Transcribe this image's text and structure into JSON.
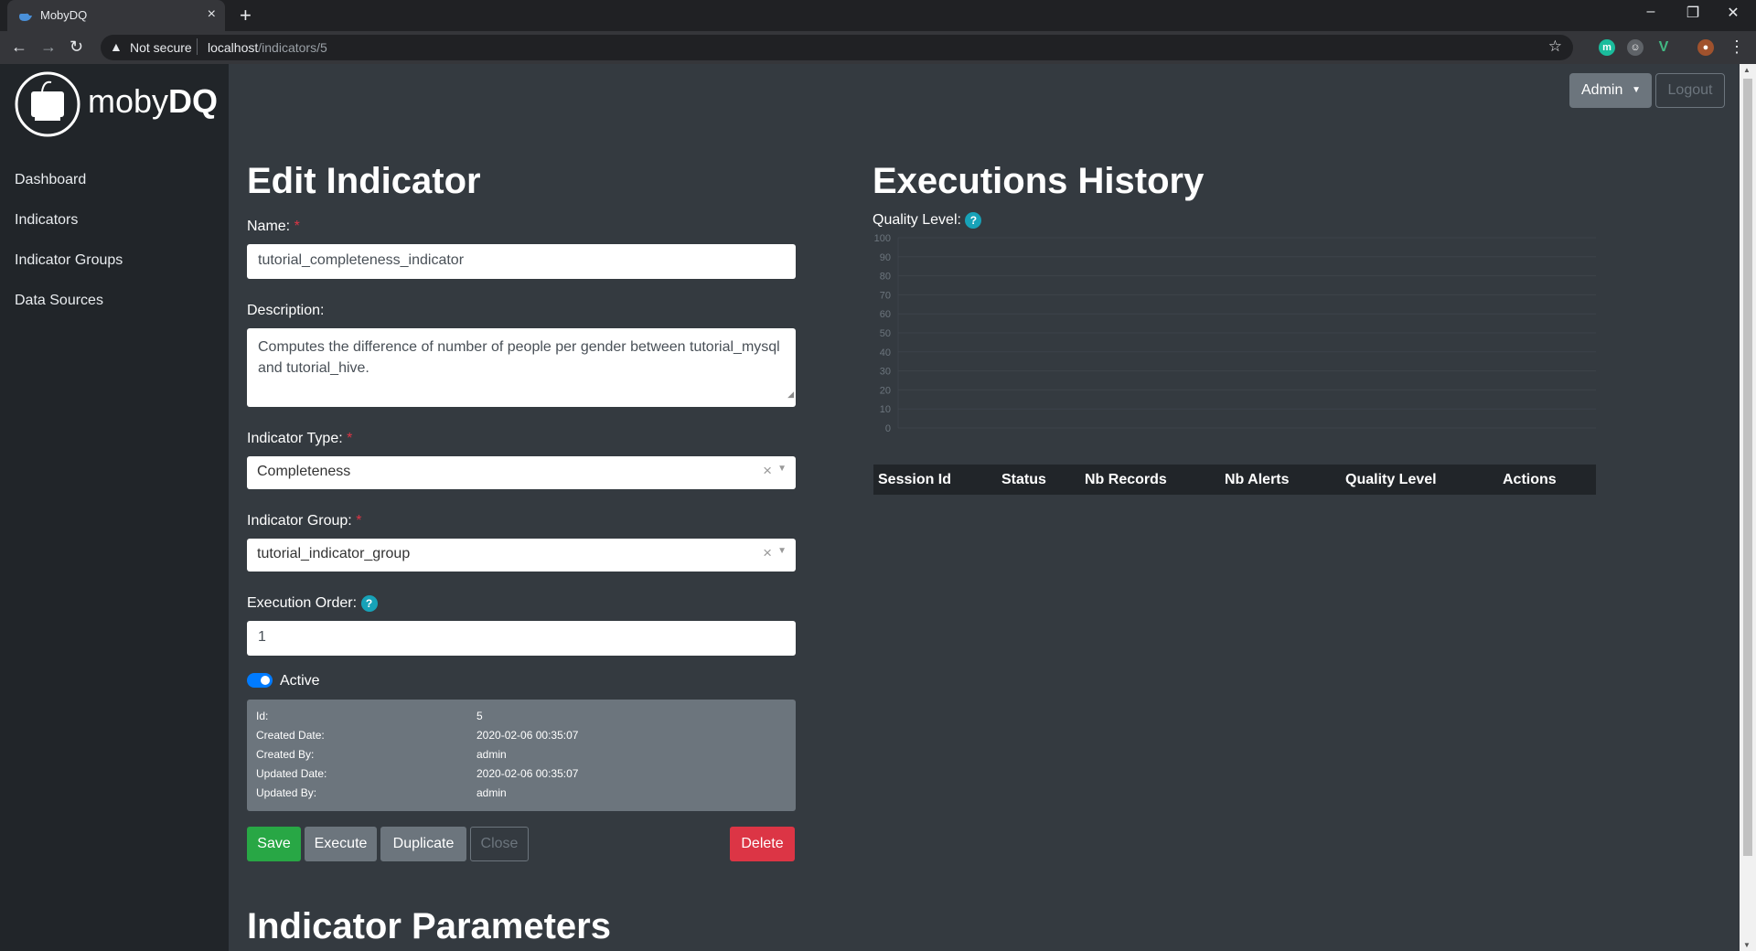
{
  "browser": {
    "tab_title": "MobyDQ",
    "security_label": "Not secure",
    "url_host": "localhost",
    "url_path": "/indicators/5"
  },
  "app": {
    "logo_plain": "moby",
    "logo_bold": "DQ"
  },
  "sidebar": {
    "items": [
      {
        "label": "Dashboard"
      },
      {
        "label": "Indicators"
      },
      {
        "label": "Indicator Groups"
      },
      {
        "label": "Data Sources"
      }
    ]
  },
  "header": {
    "admin_label": "Admin",
    "logout_label": "Logout"
  },
  "form": {
    "title": "Edit Indicator",
    "name_label": "Name:",
    "name_value": "tutorial_completeness_indicator",
    "description_label": "Description:",
    "description_value": "Computes the difference of number of people per gender between tutorial_mysql and tutorial_hive.",
    "type_label": "Indicator Type:",
    "type_value": "Completeness",
    "group_label": "Indicator Group:",
    "group_value": "tutorial_indicator_group",
    "order_label": "Execution Order:",
    "order_value": "1",
    "active_label": "Active",
    "required_mark": "*",
    "help_mark": "?",
    "clear_mark": "×"
  },
  "meta": [
    {
      "label": "Id:",
      "value": "5"
    },
    {
      "label": "Created Date:",
      "value": "2020-02-06 00:35:07"
    },
    {
      "label": "Created By:",
      "value": "admin"
    },
    {
      "label": "Updated Date:",
      "value": "2020-02-06 00:35:07"
    },
    {
      "label": "Updated By:",
      "value": "admin"
    }
  ],
  "actions": {
    "save": "Save",
    "execute": "Execute",
    "duplicate": "Duplicate",
    "close": "Close",
    "delete": "Delete"
  },
  "history": {
    "title": "Executions History",
    "quality_label": "Quality Level:",
    "columns": [
      "Session Id",
      "Status",
      "Nb Records",
      "Nb Alerts",
      "Quality Level",
      "Actions"
    ]
  },
  "params": {
    "title": "Indicator Parameters"
  },
  "chart_data": {
    "type": "line",
    "ylabel": "",
    "ylim": [
      0,
      100
    ],
    "yticks": [
      0,
      10,
      20,
      30,
      40,
      50,
      60,
      70,
      80,
      90,
      100
    ],
    "series": [],
    "grid": true
  }
}
